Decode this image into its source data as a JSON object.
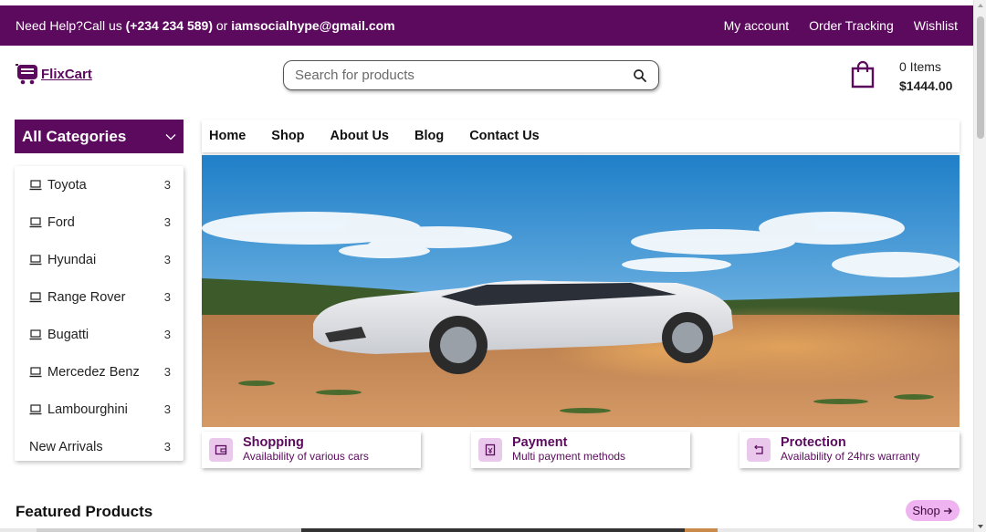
{
  "topbar": {
    "help_prefix": "Need Help?Call us ",
    "phone": "(+234 234 589)",
    "or_text": " or ",
    "email": "iamsocialhype@gmail.com",
    "links": [
      "My account",
      "Order Tracking",
      "Wishlist"
    ]
  },
  "header": {
    "logo_text": "FlixCart",
    "search_placeholder": "Search for products",
    "cart_count": "0 Items",
    "cart_total": "$1444.00"
  },
  "categories": {
    "header": "All Categories",
    "items": [
      {
        "label": "Toyota",
        "count": "3"
      },
      {
        "label": "Ford",
        "count": "3"
      },
      {
        "label": "Hyundai",
        "count": "3"
      },
      {
        "label": "Range Rover",
        "count": "3"
      },
      {
        "label": "Bugatti",
        "count": "3"
      },
      {
        "label": "Mercedez Benz",
        "count": "3"
      },
      {
        "label": "Lambourghini",
        "count": "3"
      },
      {
        "label": "New Arrivals",
        "count": "3"
      }
    ]
  },
  "nav": [
    "Home",
    "Shop",
    "About Us",
    "Blog",
    "Contact Us"
  ],
  "features": [
    {
      "title": "Shopping",
      "subtitle": "Availability of various cars",
      "icon": "wallet-icon"
    },
    {
      "title": "Payment",
      "subtitle": "Multi payment methods",
      "icon": "payment-icon"
    },
    {
      "title": "Protection",
      "subtitle": "Availability of 24hrs warranty",
      "icon": "return-icon"
    }
  ],
  "featured": {
    "title": "Featured Products",
    "shop_label": "Shop"
  },
  "colors": {
    "brand": "#5b0a5e",
    "accent_light": "#f0b3f1",
    "icon_bg": "#e9c8ec"
  }
}
